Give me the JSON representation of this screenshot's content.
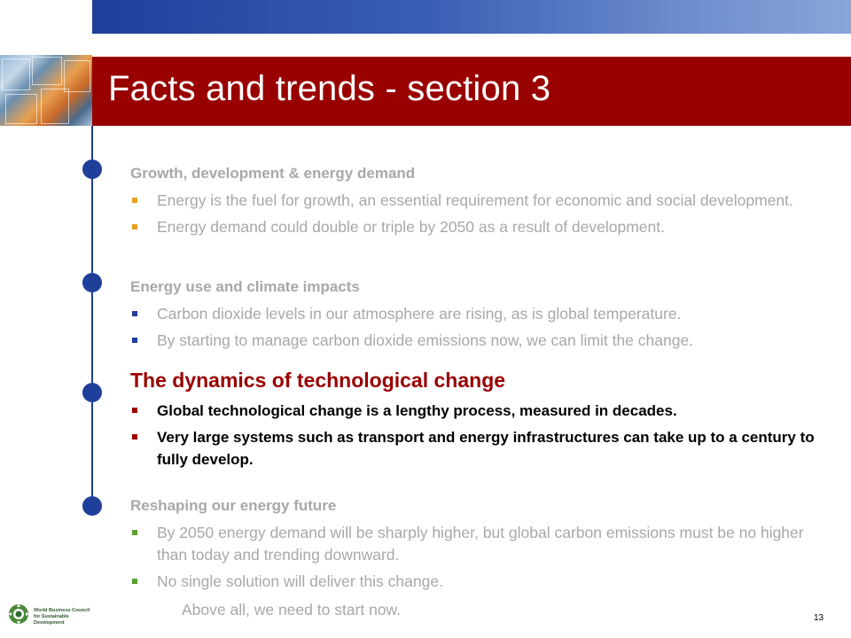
{
  "slide": {
    "title": "Facts and trends - section 3",
    "page_number": "13",
    "closing_text": "Above all, we need to start now."
  },
  "logo": {
    "icon": "wbcsd-globe-icon",
    "text": "World Business Council for Sustainable Development"
  },
  "colors": {
    "title_bar": "#990000",
    "top_bar": "#1f3f9a",
    "timeline": "#1f3f9a",
    "inactive_text": "#a8a8a8",
    "active_heading": "#990000",
    "active_text": "#000000"
  },
  "sections": [
    {
      "title": "Growth, development & energy demand",
      "bullet_color": "#e8a020",
      "bullets": [
        "Energy is the fuel for growth, an essential requirement for economic and social development.",
        "Energy demand could double or triple by 2050 as a result of development."
      ]
    },
    {
      "title": "Energy use and climate impacts",
      "bullet_color": "#1f3f9a",
      "bullets": [
        "Carbon dioxide levels in our atmosphere are rising, as is global temperature.",
        "By starting to manage carbon dioxide emissions now, we can limit the change."
      ]
    },
    {
      "title": "The dynamics of technological change",
      "bullet_color": "#990000",
      "active": true,
      "bullets": [
        "Global technological change is a lengthy process, measured in decades.",
        "Very large systems such as transport and energy infrastructures can take up to a century to fully develop."
      ]
    },
    {
      "title": "Reshaping our energy future",
      "bullet_color": "#5aa02c",
      "bullets": [
        "By 2050 energy demand will be sharply higher, but global carbon emissions must be no higher than today and trending downward.",
        "No single solution will deliver this change."
      ]
    }
  ]
}
